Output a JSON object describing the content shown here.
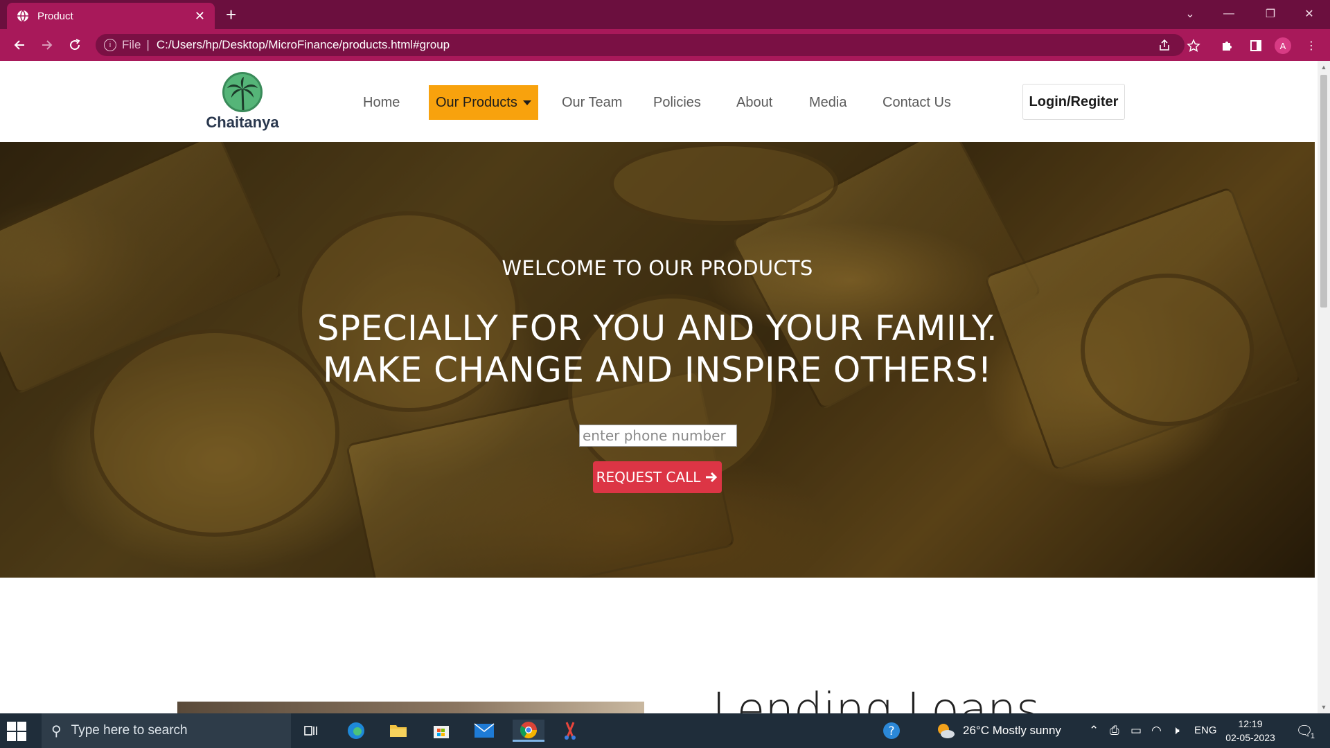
{
  "browser": {
    "tab_title": "Product",
    "new_tab": "+",
    "url_scheme": "File",
    "url": "C:/Users/hp/Desktop/MicroFinance/products.html#group",
    "profile_initial": "A"
  },
  "site": {
    "brand": "Chaitanya",
    "nav": {
      "home": "Home",
      "products": "Our Products",
      "team": "Our Team",
      "policies": "Policies",
      "about": "About",
      "media": "Media",
      "contact": "Contact Us"
    },
    "login_label": "Login/Regiter",
    "accent_color": "#f8a20d"
  },
  "hero": {
    "subtitle": "WELCOME TO OUR PRODUCTS",
    "title_line1": "SPECIALLY FOR YOU AND YOUR FAMILY.",
    "title_line2": "MAKE CHANGE AND INSPIRE OTHERS!",
    "phone_placeholder": "enter phone number",
    "request_label": "REQUEST CALL",
    "request_icon": "arrow-right-icon",
    "button_color": "#dc3545"
  },
  "section": {
    "title": "Lending Loans"
  },
  "taskbar": {
    "search_placeholder": "Type here to search",
    "weather": "26°C  Mostly sunny",
    "language": "ENG",
    "time": "12:19",
    "date": "02-05-2023",
    "notification_count": "1"
  }
}
